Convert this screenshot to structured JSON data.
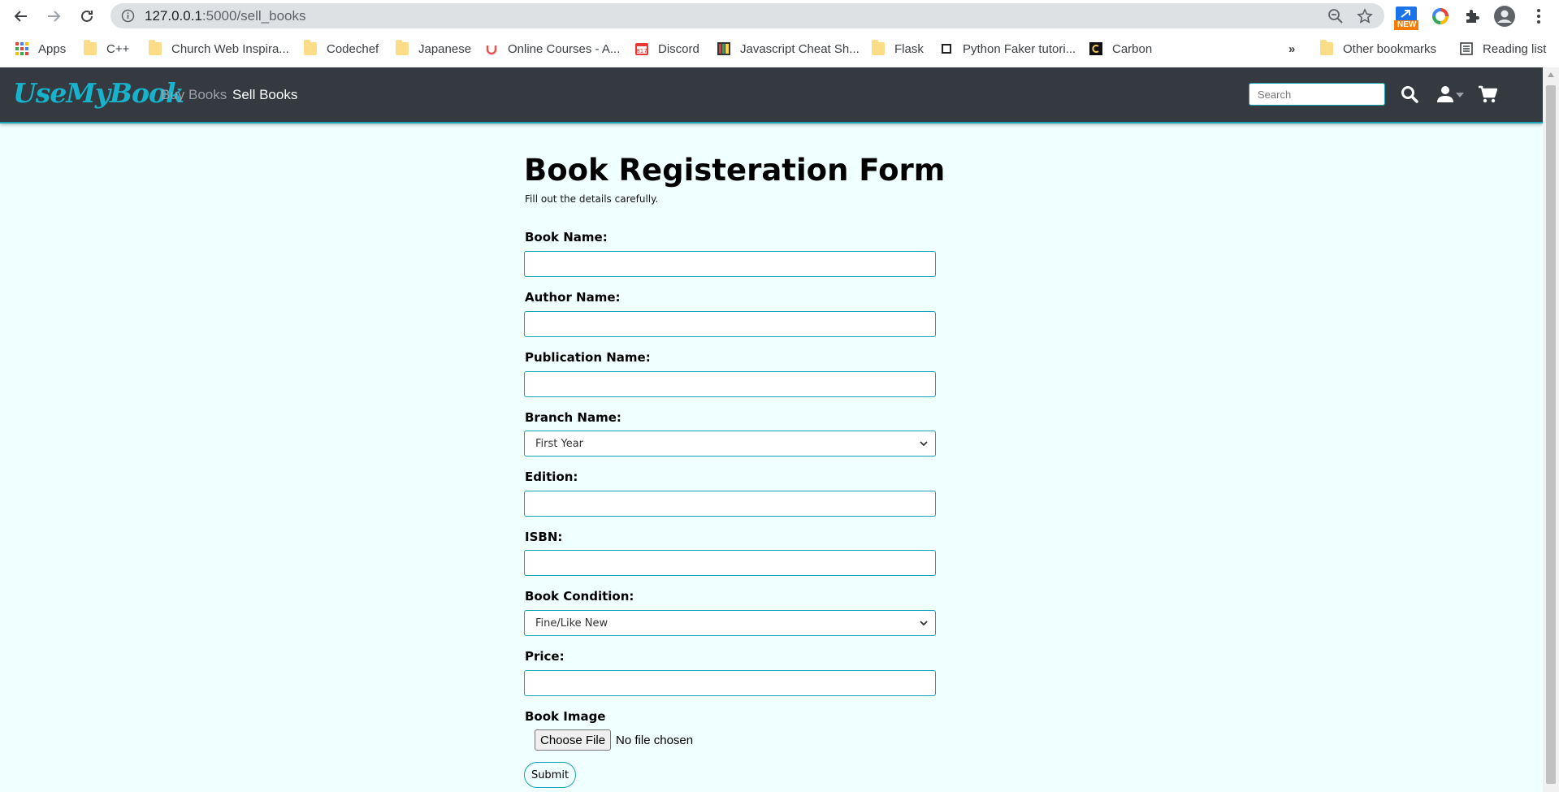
{
  "browser": {
    "url_host": "127.0.0.1",
    "url_path": ":5000/sell_books",
    "new_badge": "NEW",
    "bookmarks": [
      {
        "label": "Apps"
      },
      {
        "label": "C++"
      },
      {
        "label": "Church Web Inspira..."
      },
      {
        "label": "Codechef"
      },
      {
        "label": "Japanese"
      },
      {
        "label": "Online Courses - A..."
      },
      {
        "label": "Discord"
      },
      {
        "label": "Javascript Cheat Sh..."
      },
      {
        "label": "Flask"
      },
      {
        "label": "Python Faker tutori..."
      },
      {
        "label": "Carbon"
      }
    ],
    "overflow": "»",
    "other_bookmarks": "Other bookmarks",
    "reading_list": "Reading list"
  },
  "navbar": {
    "brand": "UseMyBook",
    "links": [
      {
        "label": "Buy Books"
      },
      {
        "label": "Sell Books"
      }
    ],
    "search_placeholder": "Search"
  },
  "form": {
    "title": "Book Registeration Form",
    "subtitle": "Fill out the details carefully.",
    "fields": {
      "book_name": {
        "label": "Book Name:",
        "value": ""
      },
      "author_name": {
        "label": "Author Name:",
        "value": ""
      },
      "publication_name": {
        "label": "Publication Name:",
        "value": ""
      },
      "branch_name": {
        "label": "Branch Name:",
        "selected": "First Year"
      },
      "edition": {
        "label": "Edition:",
        "value": ""
      },
      "isbn": {
        "label": "ISBN:",
        "value": ""
      },
      "book_condition": {
        "label": "Book Condition:",
        "selected": "Fine/Like New"
      },
      "price": {
        "label": "Price:",
        "value": ""
      },
      "book_image": {
        "label": "Book Image",
        "button": "Choose File",
        "status": "No file chosen"
      }
    },
    "submit": "Submit"
  },
  "colors": {
    "accent": "#17a2b8",
    "navbar_bg": "#343a40",
    "page_bg": "#f0ffff"
  }
}
